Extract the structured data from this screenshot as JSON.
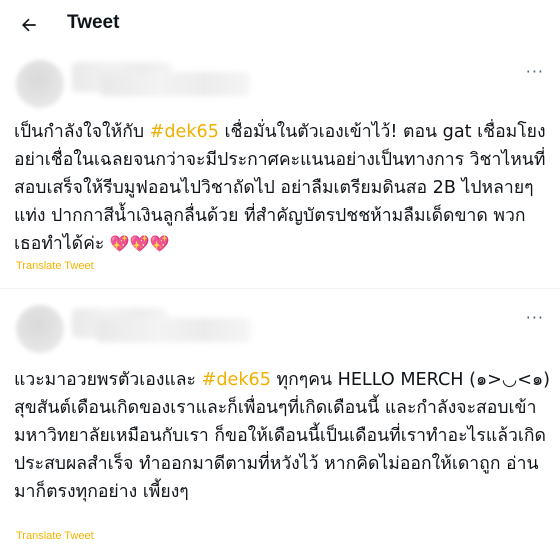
{
  "header": {
    "back_label": "←",
    "title": "Tweet"
  },
  "tweets": [
    {
      "more": "···",
      "text_a": "เป็นกำลังใจให้กับ ",
      "hashtag": "#dek65",
      "text_b": " เชื่อมั่นในตัวเองเข้าไว้! ตอน gat เชื่อมโยงอย่าเชื่อในเฉลยจนกว่าจะมีประกาศคะแนนอย่างเป็นทางการ วิชาไหนที่สอบเสร็จให้รีบมูฟออนไปวิชาถัดไป อย่าลืมเตรียมดินสอ 2B ไปหลายๆ แท่ง ปากกาสีน้ำเงินลูกลื่นด้วย ที่สำคัญบัตรปชชห้ามลืมเด็ดขาด พวกเธอทำได้ค่ะ ",
      "emoji": "💖💖💖",
      "translate": "Translate Tweet"
    },
    {
      "more": "···",
      "text_a": "แวะมาอวยพรตัวเองและ ",
      "hashtag": "#dek65",
      "text_b": " ทุกๆคน HELLO MERCH (๑>◡<๑) สุขสันต์เดือนเกิดของเราและก็เพื่อนๆที่เกิดเดือนนี้ และกำลังจะสอบเข้ามหาวิทยาลัยเหมือนกับเรา ก็ขอให้เดือนนี้เป็นเดือนที่เราทำอะไรแล้วเกิดประสบผลสำเร็จ ทำออกมาดีตามที่หวังไว้ หากคิดไม่ออกให้เดาถูก อ่านมาก็ตรงทุกอย่าง เพี้ยงๆ",
      "translate": "Translate Tweet"
    }
  ]
}
